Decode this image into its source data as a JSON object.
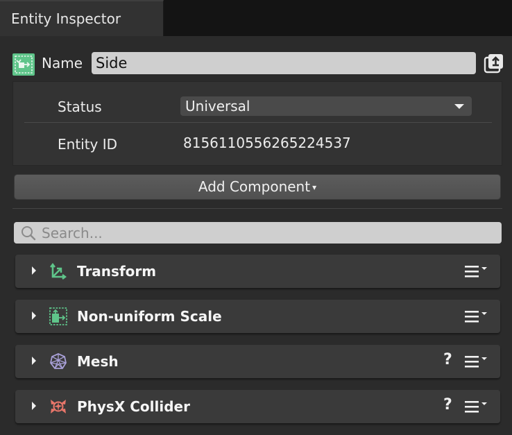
{
  "window": {
    "tab_title": "Entity Inspector"
  },
  "entity": {
    "name_label": "Name",
    "name_value": "Side",
    "status_label": "Status",
    "status_value": "Universal",
    "id_label": "Entity ID",
    "id_value": "8156110556265224537"
  },
  "toolbar": {
    "add_component_label": "Add Component",
    "add_component_arrow": "▾"
  },
  "search": {
    "placeholder": "Search..."
  },
  "components": [
    {
      "title": "Transform",
      "icon": "transform-icon",
      "has_help": false
    },
    {
      "title": "Non-uniform Scale",
      "icon": "non-uniform-scale-icon",
      "has_help": true
    },
    {
      "title": "Mesh",
      "icon": "mesh-icon",
      "has_help": true
    },
    {
      "title": "PhysX Collider",
      "icon": "physx-collider-icon",
      "has_help": true
    }
  ],
  "help_glyph": "?",
  "colors": {
    "background": "#2b2b2b",
    "title_bar": "#141414",
    "component_header": "#3a3a3a",
    "transform_icon": "#5fc58a",
    "scale_icon": "#5fc58a",
    "mesh_icon": "#a9a0d8",
    "physx_icon": "#e8766a"
  }
}
